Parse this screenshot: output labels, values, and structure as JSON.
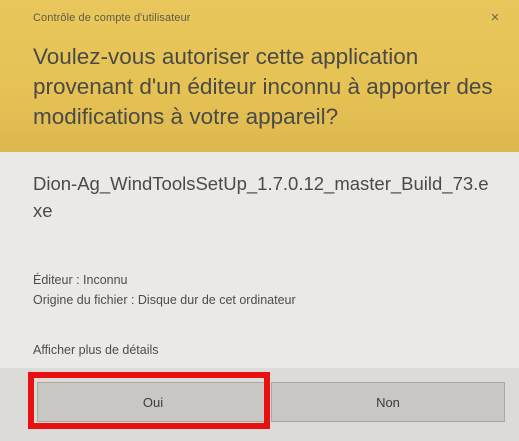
{
  "dialog": {
    "window_title": "Contrôle de compte d'utilisateur",
    "close_symbol": "×",
    "question": "Voulez-vous autoriser cette application provenant d'un éditeur inconnu à apporter des modifications à votre appareil?",
    "app_name": "Dion-Ag_WindToolsSetUp_1.7.0.12_master_Build_73.exe",
    "publisher": "Éditeur : Inconnu",
    "origin": "Origine du fichier : Disque dur de cet ordinateur",
    "details_link": "Afficher plus de détails",
    "yes_label": "Oui",
    "no_label": "Non"
  },
  "colors": {
    "header_bg": "#e6c254",
    "highlight": "#e81010"
  }
}
